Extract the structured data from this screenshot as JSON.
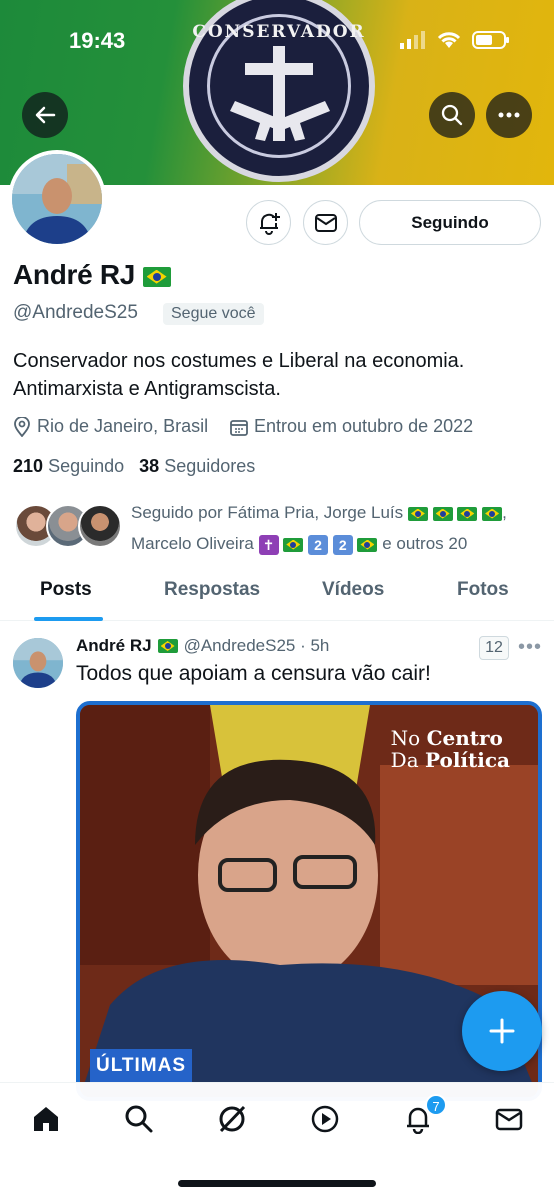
{
  "status_bar": {
    "time": "19:43"
  },
  "banner": {
    "emblem_text": "CONSERVADOR"
  },
  "header": {
    "back_icon": "arrow-left-icon",
    "search_icon": "search-icon",
    "more_icon": "more-horizontal-icon"
  },
  "profile": {
    "name": "André RJ",
    "handle": "@AndredeS25",
    "follows_you": "Segue você",
    "bio": "Conservador nos costumes e Liberal na economia. Antimarxista e Antigramscista.",
    "location": "Rio de Janeiro, Brasil",
    "joined": "Entrou em outubro de 2022",
    "following_count": "210",
    "following_label": "Seguindo",
    "followers_count": "38",
    "followers_label": "Seguidores",
    "following_button": "Seguindo",
    "followed_by_prefix": "Seguido por Fátima Pria, Jorge Luís",
    "followed_by_second": "Marcelo Oliveira",
    "followed_by_suffix": "e outros 20"
  },
  "tabs": [
    {
      "label": "Posts",
      "active": true
    },
    {
      "label": "Respostas",
      "active": false
    },
    {
      "label": "Vídeos",
      "active": false
    },
    {
      "label": "Fotos",
      "active": false
    }
  ],
  "post": {
    "author": "André RJ",
    "handle_time": "@AndredeS25 · 5h",
    "text": "Todos que apoiam a censura vão cair!",
    "views": "12",
    "media": {
      "brand_line1": "No",
      "brand_bold1": "Centro",
      "brand_line2": "Da",
      "brand_bold2": "Política",
      "tag": "ÚLTIMAS"
    }
  },
  "bottom_nav": {
    "items": [
      "home-icon",
      "search-icon",
      "grok-icon",
      "video-play-icon",
      "bell-icon",
      "mail-icon"
    ],
    "notifications_badge": "7"
  },
  "colors": {
    "accent": "#1d9bf0",
    "text": "#0f1419",
    "muted": "#536471"
  }
}
